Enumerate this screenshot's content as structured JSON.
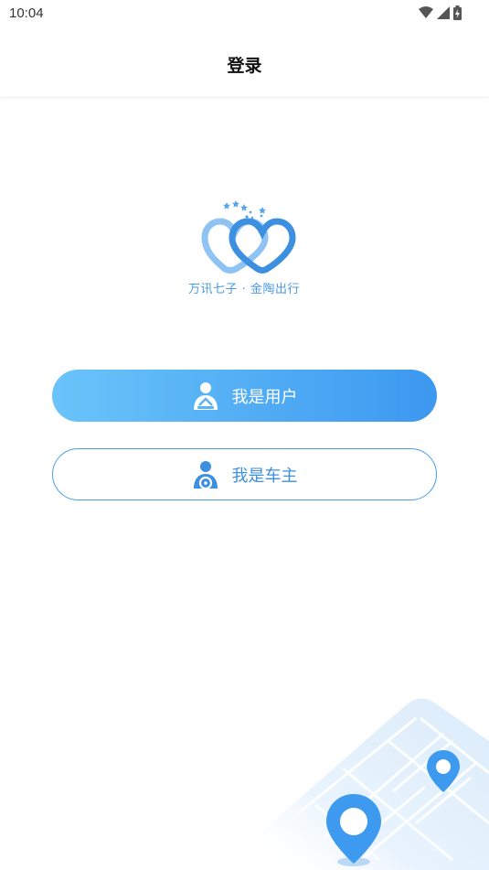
{
  "status_bar": {
    "time": "10:04",
    "icons": [
      "wifi-icon",
      "cellular-signal-icon",
      "battery-charging-icon"
    ]
  },
  "header": {
    "title": "登录"
  },
  "logo": {
    "text": "万讯七子 · 金陶出行",
    "color": "#4a9ae6"
  },
  "buttons": {
    "user": {
      "label": "我是用户",
      "icon": "passenger-icon",
      "gradient_start": "#6ac4fa",
      "gradient_end": "#3c98f0"
    },
    "owner": {
      "label": "我是车主",
      "icon": "driver-icon",
      "border_color": "#4a9ee8"
    }
  },
  "decoration": {
    "name": "map-illustration",
    "pin_color": "#3d9aef"
  }
}
